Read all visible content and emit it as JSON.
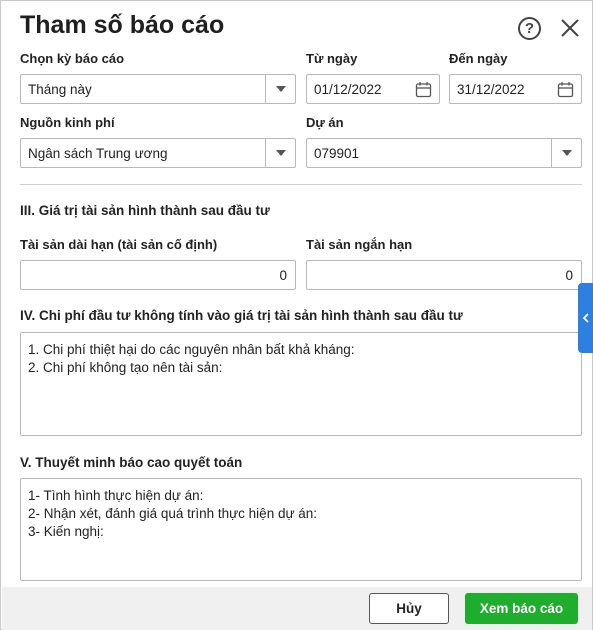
{
  "dialog": {
    "title": "Tham số báo cáo",
    "help_icon": "question-circle-icon",
    "close_icon": "close-icon"
  },
  "filters": {
    "period_label": "Chọn kỳ báo cáo",
    "period_value": "Tháng này",
    "from_label": "Từ ngày",
    "from_value": "01/12/2022",
    "to_label": "Đến ngày",
    "to_value": "31/12/2022",
    "fund_label": "Nguồn kinh phí",
    "fund_value": "Ngân sách Trung ương",
    "project_label": "Dự án",
    "project_value": "079901"
  },
  "section3": {
    "title": "III. Giá trị tài sản hình thành sau đầu tư",
    "long_term_label": "Tài sản dài hạn (tài sản cố định)",
    "long_term_value": "0",
    "short_term_label": "Tài sản ngắn hạn",
    "short_term_value": "0"
  },
  "section4": {
    "title": "IV. Chi phí đầu tư không tính vào giá trị tài sản hình thành sau đầu tư",
    "lines": [
      "1. Chi phí thiệt hại do các nguyên nhân bất khả kháng:",
      "2. Chi phí không tạo nên tài sản:"
    ]
  },
  "section5": {
    "title": "V. Thuyết minh báo cao quyết toán",
    "lines": [
      "1- Tình hình thực hiện dự án:",
      "2- Nhận xét, đánh giá quá trình thực hiện dự án:",
      "3- Kiến nghị:"
    ]
  },
  "footer": {
    "cancel_label": "Hủy",
    "view_label": "Xem báo cáo"
  },
  "colors": {
    "primary_button": "#1fad2e",
    "side_tab": "#2d7fe0"
  }
}
